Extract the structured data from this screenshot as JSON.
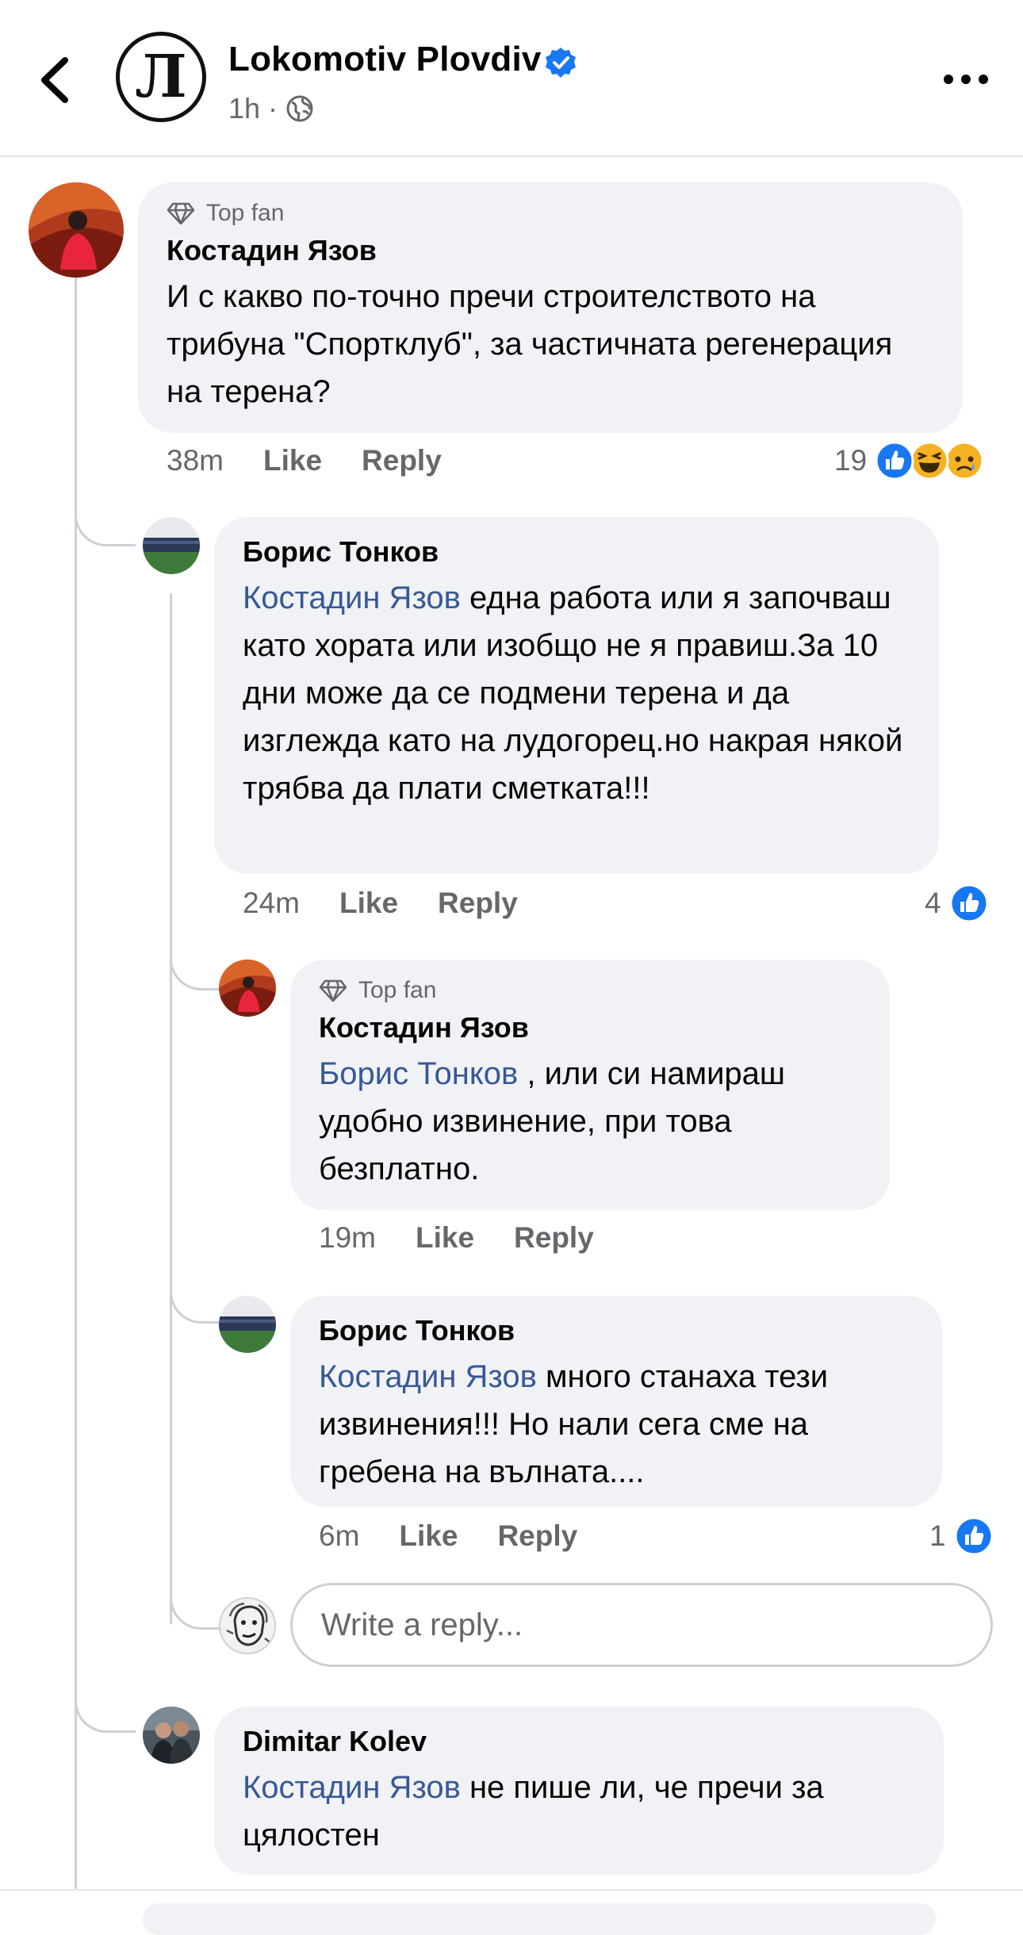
{
  "header": {
    "page_name": "Lokomotiv Plovdiv",
    "time": "1h",
    "separator": "·",
    "logo_text": "Л"
  },
  "comments": [
    {
      "top_fan_label": "Top fan",
      "author": "Костадин Язов",
      "text": "И с какво по-точно пречи строителството на трибуна \"Спортклуб\", за частичната регенерация на терена?",
      "time": "38m",
      "like_label": "Like",
      "reply_label": "Reply",
      "reaction_count": "19",
      "reactions": [
        "like-icon",
        "haha-icon",
        "sad-icon"
      ]
    },
    {
      "author": "Борис Тонков",
      "mention": "Костадин Язов",
      "text": " една работа или я започваш като хората или изобщо не я правиш.За 10 дни може да се подмени терена и да изглежда като на лудогорец.но накрая някой трябва да плати сметката!!!",
      "time": "24m",
      "like_label": "Like",
      "reply_label": "Reply",
      "reaction_count": "4"
    },
    {
      "top_fan_label": "Top fan",
      "author": "Костадин Язов",
      "mention": "Борис Тонков",
      "text": " , или си намираш удобно извинение, при това безплатно.",
      "time": "19m",
      "like_label": "Like",
      "reply_label": "Reply"
    },
    {
      "author": "Борис Тонков",
      "mention": "Костадин Язов",
      "text": " много станаха тези извинения!!! Но нали сега сме на гребена на вълната....",
      "time": "6m",
      "like_label": "Like",
      "reply_label": "Reply",
      "reaction_count": "1"
    },
    {
      "author": "Dimitar Kolev",
      "mention": "Костадин Язов",
      "text": " не пише ли, че пречи за цялостен"
    }
  ],
  "reply_box": {
    "placeholder": "Write a reply..."
  },
  "colors": {
    "accent": "#1877f2",
    "mention": "#385898",
    "bubble": "#f0f2f5",
    "secondary_text": "#65676b"
  }
}
